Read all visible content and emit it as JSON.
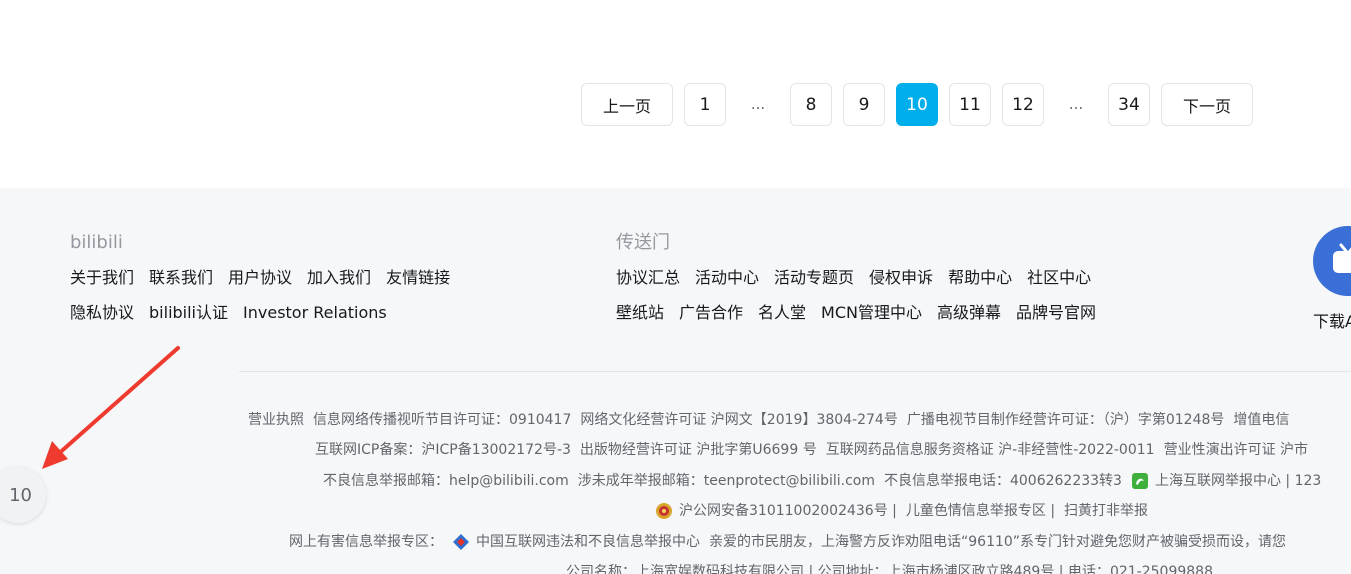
{
  "pagination": {
    "prev_label": "上一页",
    "next_label": "下一页",
    "ellipsis": "...",
    "pages": [
      "1",
      "8",
      "9",
      "10",
      "11",
      "12",
      "34"
    ],
    "current": "10"
  },
  "footer": {
    "col1": {
      "title": "bilibili",
      "row1": [
        "关于我们",
        "联系我们",
        "用户协议",
        "加入我们",
        "友情链接"
      ],
      "row2": [
        "隐私协议",
        "bilibili认证",
        "Investor Relations"
      ]
    },
    "col2": {
      "title": "传送门",
      "row1": [
        "协议汇总",
        "活动中心",
        "活动专题页",
        "侵权申诉",
        "帮助中心",
        "社区中心"
      ],
      "row2": [
        "壁纸站",
        "广告合作",
        "名人堂",
        "MCN管理中心",
        "高级弹幕",
        "品牌号官网"
      ]
    },
    "download_label": "下载A",
    "info": {
      "line1": [
        "营业执照",
        "信息网络传播视听节目许可证：0910417",
        "网络文化经营许可证 沪网文【2019】3804-274号",
        "广播电视节目制作经营许可证：（沪）字第01248号",
        "增值电信"
      ],
      "line2": [
        "互联网ICP备案：沪ICP备13002172号-3",
        "出版物经营许可证 沪批字第U6699 号",
        "互联网药品信息服务资格证 沪-非经营性-2022-0011",
        "营业性演出许可证 沪市"
      ],
      "line3": [
        "不良信息举报邮箱：help@bilibili.com",
        "涉未成年举报邮箱：teenprotect@bilibili.com",
        "不良信息举报电话：4006262233转3"
      ],
      "line3_report": "上海互联网举报中心 |  123",
      "line4_police": "沪公网安备31011002002436号 |",
      "line4_rest": [
        "儿童色情信息举报专区 |",
        "扫黄打非举报"
      ],
      "line5_label": "网上有害信息举报专区：",
      "line5_center": "中国互联网违法和不良信息举报中心",
      "line5_notice": "亲爱的市民朋友，上海警方反诈劝阻电话“96110”系专门针对避免您财产被骗受损而设，请您",
      "line6": "公司名称：上海宽娱数码科技有限公司 |  公司地址：上海市杨浦区政立路489号 |  电话：021-25099888"
    }
  },
  "page_indicator": "10",
  "colors": {
    "accent": "#00aeec",
    "footer_bg": "#f6f7f8",
    "annotation_arrow": "#ee3a2f"
  }
}
